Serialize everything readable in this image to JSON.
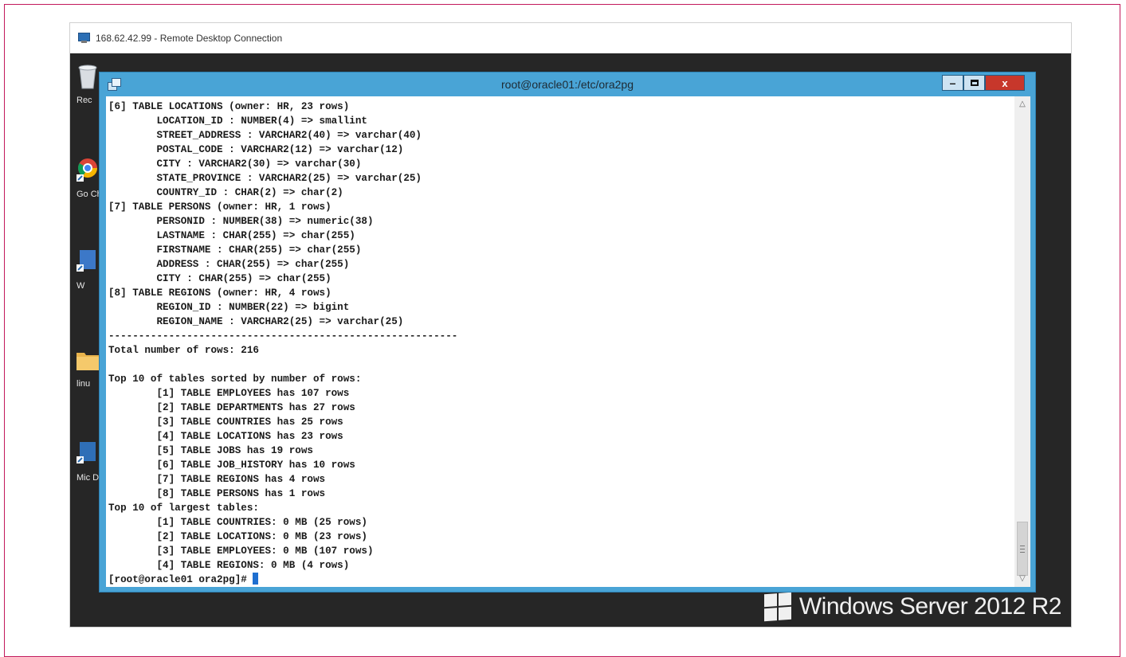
{
  "rdp": {
    "title": "168.62.42.99 - Remote Desktop Connection"
  },
  "desktop": {
    "icons": [
      {
        "label": "Rec",
        "icon": "recycle-bin-icon"
      },
      {
        "label": "Go Ch",
        "icon": "chrome-icon"
      },
      {
        "label": "W",
        "icon": "shortcut-icon"
      },
      {
        "label": "linu",
        "icon": "folder-icon"
      },
      {
        "label": "Mic Dat",
        "icon": "shortcut-icon"
      }
    ],
    "brand": "Windows Server 2012 R2"
  },
  "putty": {
    "title": "root@oracle01:/etc/ora2pg",
    "controls": {
      "minimize": "minimize-icon",
      "maximize": "maximize-icon",
      "close": "x"
    }
  },
  "terminal": {
    "lines": [
      "[6] TABLE LOCATIONS (owner: HR, 23 rows)",
      "        LOCATION_ID : NUMBER(4) => smallint",
      "        STREET_ADDRESS : VARCHAR2(40) => varchar(40)",
      "        POSTAL_CODE : VARCHAR2(12) => varchar(12)",
      "        CITY : VARCHAR2(30) => varchar(30)",
      "        STATE_PROVINCE : VARCHAR2(25) => varchar(25)",
      "        COUNTRY_ID : CHAR(2) => char(2)",
      "[7] TABLE PERSONS (owner: HR, 1 rows)",
      "        PERSONID : NUMBER(38) => numeric(38)",
      "        LASTNAME : CHAR(255) => char(255)",
      "        FIRSTNAME : CHAR(255) => char(255)",
      "        ADDRESS : CHAR(255) => char(255)",
      "        CITY : CHAR(255) => char(255)",
      "[8] TABLE REGIONS (owner: HR, 4 rows)",
      "        REGION_ID : NUMBER(22) => bigint",
      "        REGION_NAME : VARCHAR2(25) => varchar(25)",
      "----------------------------------------------------------",
      "Total number of rows: 216",
      "",
      "Top 10 of tables sorted by number of rows:",
      "        [1] TABLE EMPLOYEES has 107 rows",
      "        [2] TABLE DEPARTMENTS has 27 rows",
      "        [3] TABLE COUNTRIES has 25 rows",
      "        [4] TABLE LOCATIONS has 23 rows",
      "        [5] TABLE JOBS has 19 rows",
      "        [6] TABLE JOB_HISTORY has 10 rows",
      "        [7] TABLE REGIONS has 4 rows",
      "        [8] TABLE PERSONS has 1 rows",
      "Top 10 of largest tables:",
      "        [1] TABLE COUNTRIES: 0 MB (25 rows)",
      "        [2] TABLE LOCATIONS: 0 MB (23 rows)",
      "        [3] TABLE EMPLOYEES: 0 MB (107 rows)",
      "        [4] TABLE REGIONS: 0 MB (4 rows)"
    ],
    "prompt": "[root@oracle01 ora2pg]# "
  },
  "scrollbar": {
    "position": 0.95
  },
  "colors": {
    "putty_frame": "#49a4d6",
    "close_button": "#c7372b",
    "cursor": "#1f6fd0",
    "desktop": "#262626"
  }
}
